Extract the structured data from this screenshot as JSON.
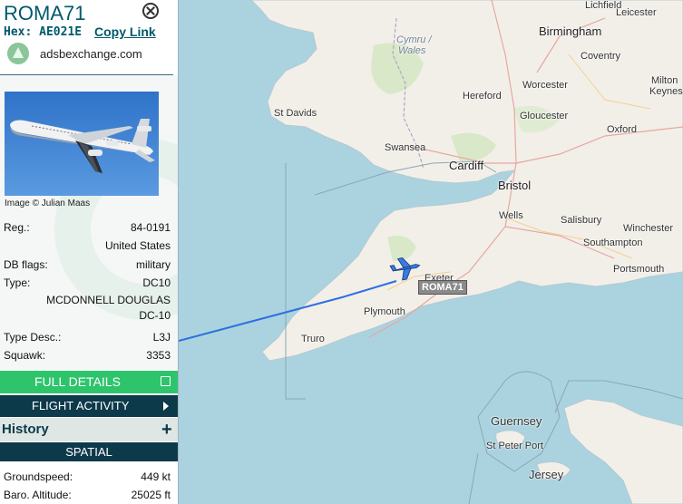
{
  "aircraft": {
    "callsign": "ROMA71",
    "hex_line": "Hex: AE021E",
    "copy_link": "Copy Link",
    "site": "adsbexchange.com",
    "image_credit": "Image © Julian Maas"
  },
  "details": {
    "reg_label": "Reg.:",
    "reg_value": "84-0191",
    "country": "United States",
    "dbflags_label": "DB flags:",
    "dbflags_value": "military",
    "type_label": "Type:",
    "type_value": "DC10",
    "manufacturer": "MCDONNELL DOUGLAS",
    "model": "DC-10",
    "typedesc_label": "Type Desc.:",
    "typedesc_value": "L3J",
    "squawk_label": "Squawk:",
    "squawk_value": "3353"
  },
  "buttons": {
    "full_details": "FULL DETAILS",
    "flight_activity": "FLIGHT ACTIVITY",
    "history": "History",
    "spatial": "SPATIAL"
  },
  "spatial": {
    "groundspeed_label": "Groundspeed:",
    "groundspeed_value": "449 kt",
    "altitude_label": "Baro. Altitude:",
    "altitude_value": "25025 ft"
  },
  "map": {
    "aircraft_label": "ROMA71",
    "places": {
      "lichfield": "Lichfield",
      "leicester": "Leicester",
      "birmingham": "Birmingham",
      "cymru": "Cymru /",
      "wales": "Wales",
      "coventry": "Coventry",
      "worcester": "Worcester",
      "milton": "Milton",
      "keynes": "Keynes",
      "hereford": "Hereford",
      "st_davids": "St Davids",
      "gloucester": "Gloucester",
      "oxford": "Oxford",
      "swansea": "Swansea",
      "cardiff": "Cardiff",
      "bristol": "Bristol",
      "wells": "Wells",
      "salisbury": "Salisbury",
      "winchester": "Winchester",
      "southampton": "Southampton",
      "portsmouth": "Portsmouth",
      "exeter": "Exeter",
      "plymouth": "Plymouth",
      "truro": "Truro",
      "guernsey": "Guernsey",
      "st_peter_port": "St Peter Port",
      "jersey": "Jersey"
    }
  },
  "colors": {
    "accent": "#00596b",
    "full_details_bg": "#2ec46c",
    "dark_bar": "#0d3a4a",
    "track": "#2f6fe0",
    "aircraft": "#3a7be0",
    "land": "#f2efe9",
    "sea": "#aad3df"
  }
}
